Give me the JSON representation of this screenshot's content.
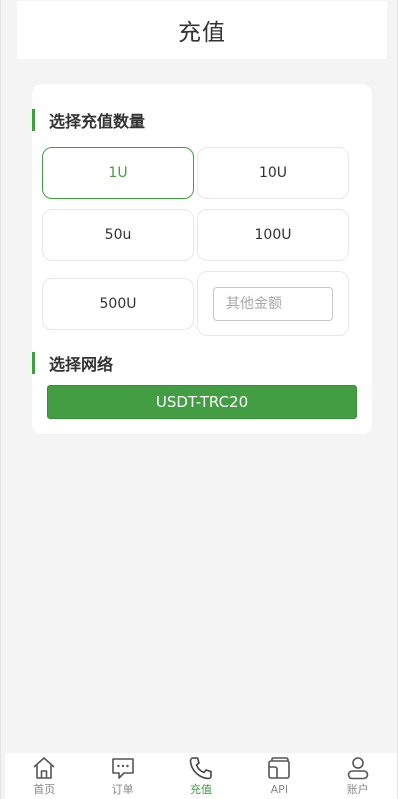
{
  "header": {
    "title": "充值"
  },
  "amount_section": {
    "title": "选择充值数量",
    "options": [
      {
        "label": "1U",
        "selected": true
      },
      {
        "label": "10U",
        "selected": false
      },
      {
        "label": "50u",
        "selected": false
      },
      {
        "label": "100U",
        "selected": false
      },
      {
        "label": "500U",
        "selected": false
      }
    ],
    "custom_placeholder": "其他金额"
  },
  "network_section": {
    "title": "选择网络",
    "selected_network": "USDT-TRC20"
  },
  "tabbar": {
    "items": [
      {
        "label": "首页",
        "icon": "home-icon",
        "active": false
      },
      {
        "label": "订单",
        "icon": "chat-icon",
        "active": false
      },
      {
        "label": "充值",
        "icon": "phone-icon",
        "active": true
      },
      {
        "label": "API",
        "icon": "wallet-icon",
        "active": false
      },
      {
        "label": "账户",
        "icon": "user-icon",
        "active": false
      }
    ]
  },
  "colors": {
    "accent": "#3fa03f",
    "button": "#439e43",
    "background": "#f4f4f4"
  }
}
